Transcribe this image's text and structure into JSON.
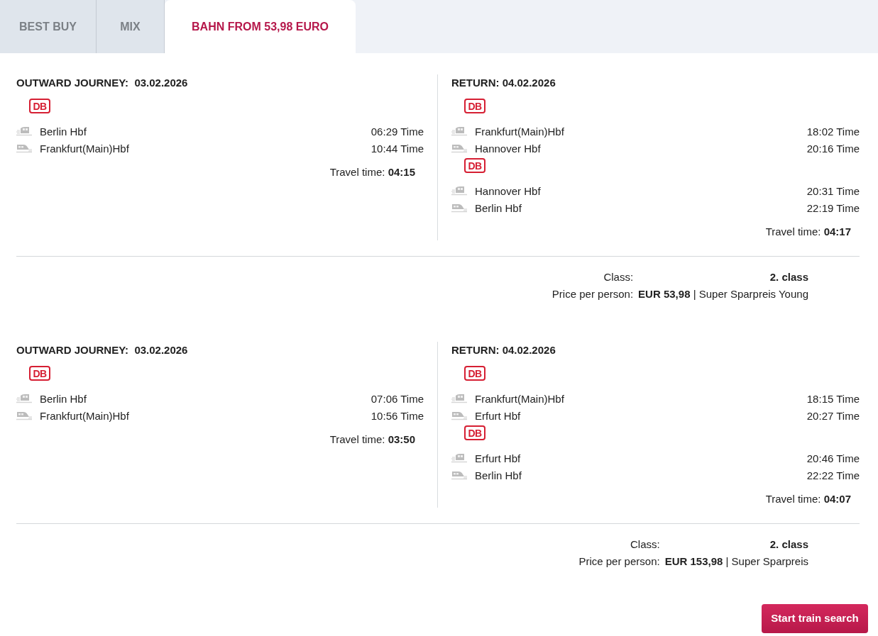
{
  "tabs": [
    {
      "label": "BEST BUY",
      "selected": false
    },
    {
      "label": "MIX",
      "selected": false
    },
    {
      "label": "BAHN FROM 53,98 EURO",
      "selected": true
    }
  ],
  "offers": [
    {
      "columns": [
        {
          "title": "OUTWARD JOURNEY:  03.02.2026",
          "legs": [
            {
              "operator": "DB",
              "stops": [
                {
                  "kind": "departure",
                  "station": "Berlin Hbf",
                  "time": "06:29 Time"
                },
                {
                  "kind": "arrival",
                  "station": "Frankfurt(Main)Hbf",
                  "time": "10:44 Time"
                }
              ]
            }
          ],
          "travel_time": "Travel time: **04:15**"
        },
        {
          "title": "RETURN: 04.02.2026",
          "legs": [
            {
              "operator": "DB",
              "stops": [
                {
                  "kind": "departure",
                  "station": "Frankfurt(Main)Hbf",
                  "time": "18:02 Time"
                },
                {
                  "kind": "arrival",
                  "station": "Hannover Hbf",
                  "time": "20:16 Time"
                }
              ]
            },
            {
              "operator": "DB",
              "stops": [
                {
                  "kind": "departure",
                  "station": "Hannover Hbf",
                  "time": "20:31 Time"
                },
                {
                  "kind": "arrival",
                  "station": "Berlin Hbf",
                  "time": "22:19 Time"
                }
              ]
            }
          ],
          "travel_time": "Travel time: **04:17**"
        }
      ],
      "details": [
        {
          "kind": "class",
          "label": "Class:",
          "value": "2. class"
        },
        {
          "kind": "price",
          "label": "Price per person:",
          "value": "**EUR 53,98** | Super Sparpreis Young"
        }
      ]
    },
    {
      "columns": [
        {
          "title": "OUTWARD JOURNEY:  03.02.2026",
          "legs": [
            {
              "operator": "DB",
              "stops": [
                {
                  "kind": "departure",
                  "station": "Berlin Hbf",
                  "time": "07:06 Time"
                },
                {
                  "kind": "arrival",
                  "station": "Frankfurt(Main)Hbf",
                  "time": "10:56 Time"
                }
              ]
            }
          ],
          "travel_time": "Travel time: **03:50**"
        },
        {
          "title": "RETURN: 04.02.2026",
          "legs": [
            {
              "operator": "DB",
              "stops": [
                {
                  "kind": "departure",
                  "station": "Frankfurt(Main)Hbf",
                  "time": "18:15 Time"
                },
                {
                  "kind": "arrival",
                  "station": "Erfurt Hbf",
                  "time": "20:27 Time"
                }
              ]
            },
            {
              "operator": "DB",
              "stops": [
                {
                  "kind": "departure",
                  "station": "Erfurt Hbf",
                  "time": "20:46 Time"
                },
                {
                  "kind": "arrival",
                  "station": "Berlin Hbf",
                  "time": "22:22 Time"
                }
              ]
            }
          ],
          "travel_time": "Travel time: **04:07**"
        }
      ],
      "details": [
        {
          "kind": "class",
          "label": "Class:",
          "value": "2. class"
        },
        {
          "kind": "price",
          "label": "Price per person:",
          "value": "**EUR 153,98** | Super Sparpreis"
        }
      ]
    }
  ],
  "search_button": "Start train search"
}
